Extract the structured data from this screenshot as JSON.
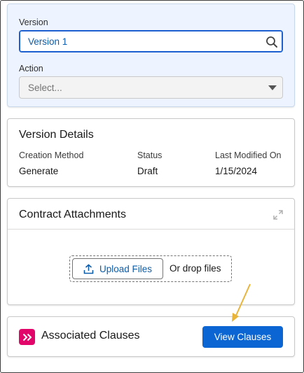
{
  "version_field": {
    "label": "Version",
    "value": "Version 1",
    "icon": "search-icon"
  },
  "action_field": {
    "label": "Action",
    "placeholder": "Select...",
    "icon": "chevron-down-icon"
  },
  "version_details": {
    "title": "Version Details",
    "columns": [
      {
        "header": "Creation Method",
        "value": "Generate"
      },
      {
        "header": "Status",
        "value": "Draft"
      },
      {
        "header": "Last Modified On",
        "value": "1/15/2024"
      }
    ]
  },
  "contract_attachments": {
    "title": "Contract Attachments",
    "upload_label": "Upload Files",
    "drop_text": "Or drop files",
    "icons": [
      "expand-icon",
      "upload-icon"
    ]
  },
  "associated_clauses": {
    "title": "Associated Clauses",
    "button_label": "View Clauses",
    "icon": "double-chevron-right-icon"
  },
  "colors": {
    "accent": "#0b66d4",
    "link": "#0b5cab",
    "form_bg": "#edf4ff",
    "clause_icon": "#e3066a",
    "annotation_arrow": "#e8b43a"
  }
}
